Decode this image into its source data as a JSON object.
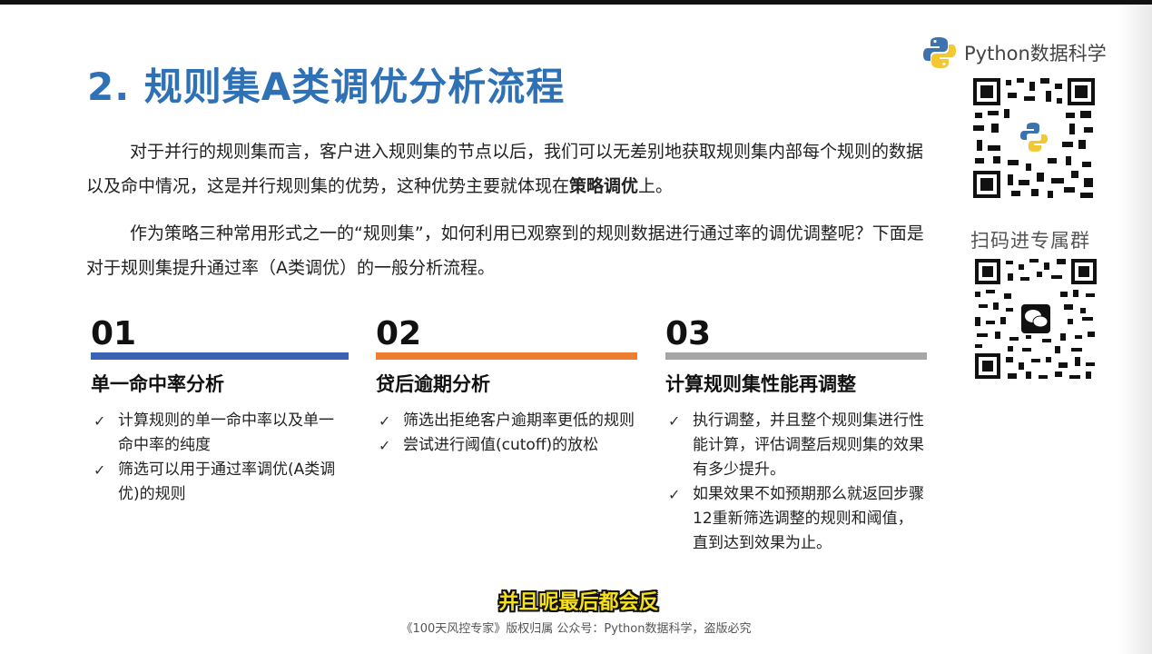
{
  "slide": {
    "title": "2. 规则集A类调优分析流程",
    "para1_text": "对于并行的规则集而言，客户进入规则集的节点以后，我们可以无差别地获取规则集内部每个规则的数据以及命中情况，这是并行规则集的优势，这种优势主要就体现在",
    "para1_bold": "策略调优",
    "para1_end": "上。",
    "para2": "作为策略三种常用形式之一的“规则集”，如何利用已观察到的规则数据进行通过率的调优调整呢？下面是对于规则集提升通过率（A类调优）的一般分析流程。",
    "columns": [
      {
        "number": "01",
        "heading": "单一命中率分析",
        "items": [
          "计算规则的单一命中率以及单一命中率的纯度",
          "筛选可以用于通过率调优(A类调优)的规则"
        ]
      },
      {
        "number": "02",
        "heading": "贷后逾期分析",
        "items": [
          "筛选出拒绝客户逾期率更低的规则",
          "尝试进行阈值(cutoff)的放松"
        ]
      },
      {
        "number": "03",
        "heading": "计算规则集性能再调整",
        "items": [
          "执行调整，并且整个规则集进行性能计算，评估调整后规则集的效果有多少提升。",
          "如果效果不如预期那么就返回步骤12重新筛选调整的规则和阈值，直到达到效果为止。"
        ]
      }
    ],
    "check_glyph": "✓"
  },
  "sidebar": {
    "brand": "Python数据科学",
    "qr_label": "扫码进专属群"
  },
  "video": {
    "subtitle": "并且呢最后都会反",
    "copyright": "《100天风控专家》版权归属 公众号：Python数据科学，盗版必究"
  },
  "colors": {
    "title": "#2f71b5",
    "bar1": "#3a63b4",
    "bar2": "#ed7d31",
    "bar3": "#a6a6a6",
    "subtitle": "#f6e01a"
  }
}
